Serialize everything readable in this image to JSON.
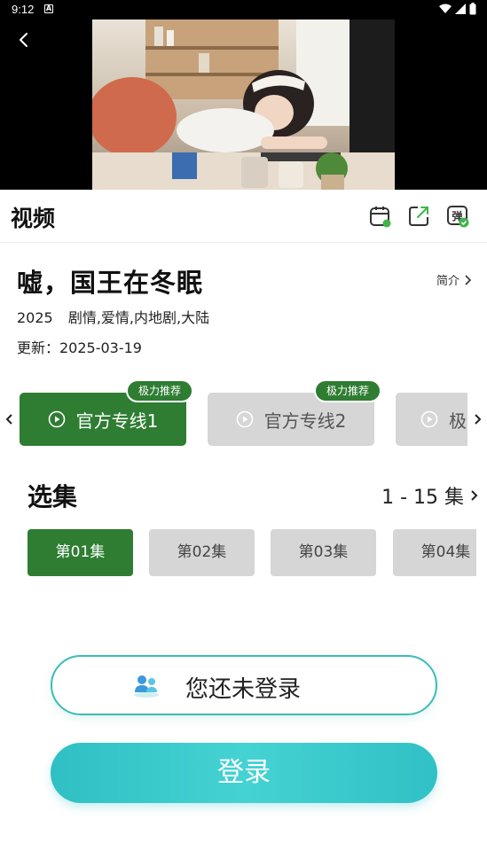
{
  "status_bar": {
    "time": "9:12",
    "a_icon": "A"
  },
  "header": {
    "title": "视频"
  },
  "show": {
    "title": "嘘，国王在冬眠",
    "intro_label": "简介",
    "year": "2025",
    "genres": "剧情,爱情,内地剧,大陆",
    "update": "更新：2025-03-19"
  },
  "sources": [
    {
      "label": "官方专线1",
      "badge": "极力推荐",
      "active": true
    },
    {
      "label": "官方专线2",
      "badge": "极力推荐",
      "active": false
    },
    {
      "label": "极",
      "badge": "",
      "active": false
    }
  ],
  "episodes": {
    "title": "选集",
    "range": "1 - 15 集",
    "items": [
      "第01集",
      "第02集",
      "第03集",
      "第04集"
    ]
  },
  "login": {
    "status_text": "您还未登录",
    "button_label": "登录"
  },
  "colors": {
    "accent": "#2e7d32",
    "teal": "#3bbcb7",
    "inactive": "#d6d6d6"
  },
  "icons": [
    "back-arrow-icon",
    "calendar-icon",
    "share-icon",
    "danmaku-icon",
    "chevron-right-icon",
    "play-circle-icon",
    "users-icon"
  ]
}
